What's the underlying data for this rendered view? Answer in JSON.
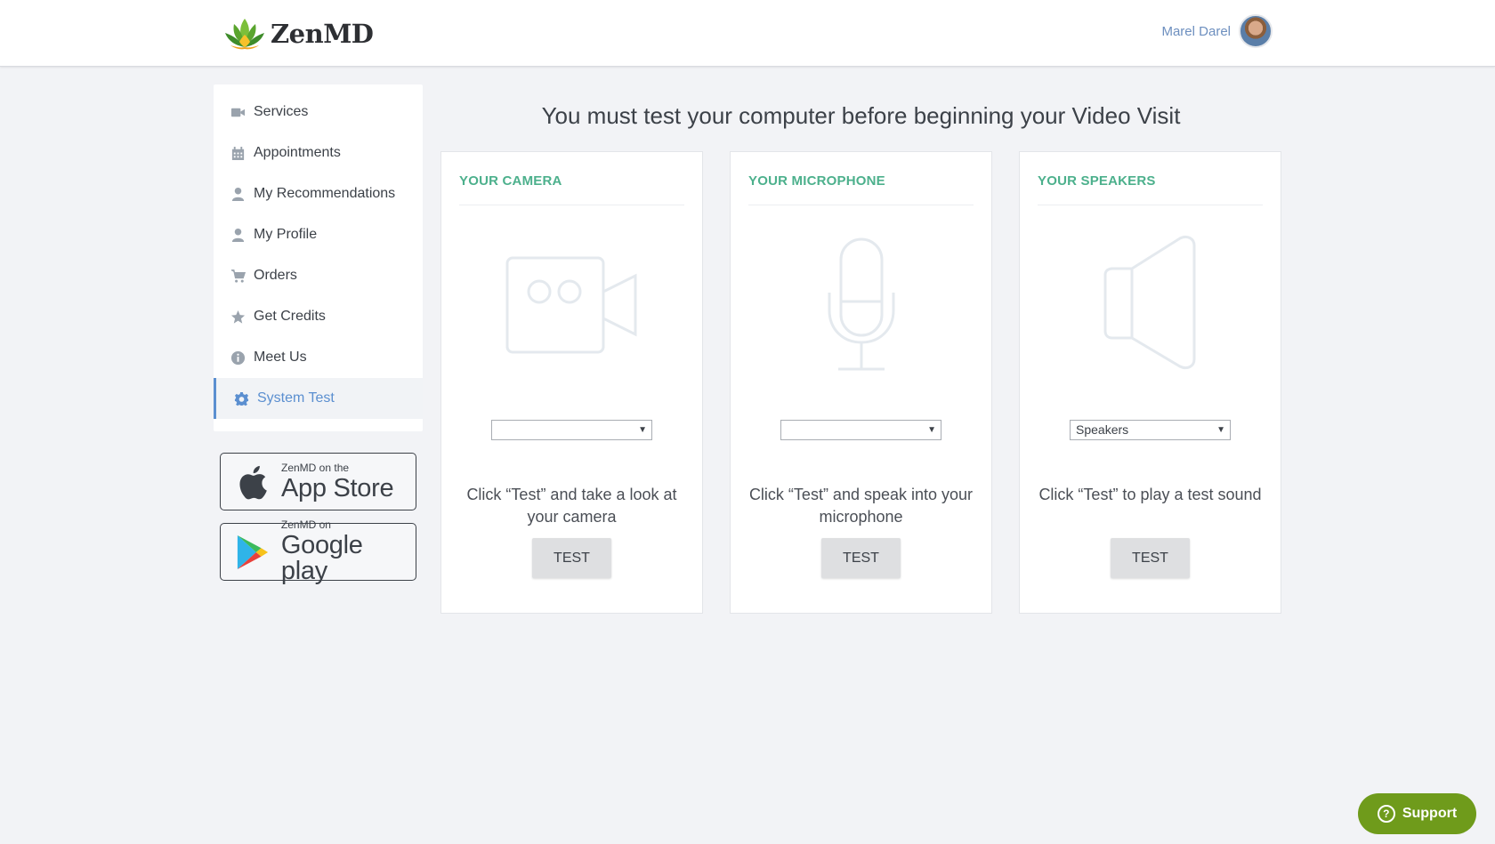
{
  "header": {
    "logo_text": "ZenMD",
    "user_name": "Marel Darel"
  },
  "sidebar": {
    "items": [
      {
        "label": "Services",
        "icon": "video-camera-icon"
      },
      {
        "label": "Appointments",
        "icon": "calendar-icon"
      },
      {
        "label": "My Recommendations",
        "icon": "user-icon"
      },
      {
        "label": "My Profile",
        "icon": "user-icon"
      },
      {
        "label": "Orders",
        "icon": "cart-icon"
      },
      {
        "label": "Get Credits",
        "icon": "star-icon"
      },
      {
        "label": "Meet Us",
        "icon": "info-icon"
      },
      {
        "label": "System Test",
        "icon": "gear-icon",
        "active": true
      }
    ],
    "active_color": "#5b8fd0"
  },
  "stores": {
    "apple_small": "ZenMD on the",
    "apple_big": "App Store",
    "google_small": "ZenMD on",
    "google_big": "Google play"
  },
  "main": {
    "title": "You must test your computer before beginning your Video Visit",
    "accent_color": "#4cb08c",
    "cards": [
      {
        "title": "YOUR CAMERA",
        "icon": "video-camera-icon",
        "select_value": "",
        "desc": "Click “Test” and take a look at your camera",
        "button": "TEST"
      },
      {
        "title": "YOUR MICROPHONE",
        "icon": "microphone-icon",
        "select_value": "",
        "desc": "Click “Test” and speak into your microphone",
        "button": "TEST"
      },
      {
        "title": "YOUR SPEAKERS",
        "icon": "speaker-icon",
        "select_value": "Speakers",
        "desc": "Click “Test” to play a test sound",
        "button": "TEST"
      }
    ]
  },
  "support": {
    "label": "Support",
    "color": "#6f9b1b"
  }
}
